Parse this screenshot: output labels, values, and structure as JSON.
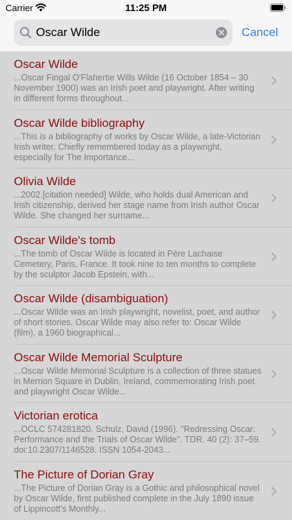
{
  "status_bar": {
    "carrier": "Carrier",
    "time": "11:25 PM"
  },
  "search": {
    "query": "Oscar Wilde",
    "cancel_label": "Cancel"
  },
  "results": [
    {
      "title": "Oscar Wilde",
      "snippet": "...Oscar Fingal O'Flahertie Wills Wilde (16 October 1854 – 30 November 1900) was an Irish poet and playwright. After writing in different forms throughout..."
    },
    {
      "title": "Oscar Wilde bibliography",
      "snippet": "...This is a bibliography of works by Oscar Wilde, a late-Victorian Irish writer. Chiefly remembered today as a playwright, especially for The Importance..."
    },
    {
      "title": "Olivia Wilde",
      "snippet": "...2002.[citation needed] Wilde, who holds dual American and Irish citizenship, derived her stage name from Irish author Oscar Wilde. She changed her surname..."
    },
    {
      "title": "Oscar Wilde's tomb",
      "snippet": "...The tomb of Oscar Wilde is located in Père Lachaise Cemetery, Paris, France. It took nine to ten months to complete by the sculptor Jacob Epstein, with..."
    },
    {
      "title": "Oscar Wilde (disambiguation)",
      "snippet": "...Oscar Wilde was an Irish playwright, novelist, poet, and author of short stories. Oscar Wilde may also refer to: Oscar Wilde (film), a 1960 biographical..."
    },
    {
      "title": "Oscar Wilde Memorial Sculpture",
      "snippet": "...Oscar Wilde Memorial Sculpture is a collection of three statues in Merrion Square in Dublin, Ireland, commemorating Irish poet and playwright Oscar Wilde..."
    },
    {
      "title": "Victorian erotica",
      "snippet": "...OCLC 574281820. Schulz, David (1996). \"Redressing Oscar: Performance and the Trials of Oscar Wilde\". TDR. 40 (2): 37–59. doi:10.2307/1146528. ISSN 1054-2043..."
    },
    {
      "title": "The Picture of Dorian Gray",
      "snippet": "...The Picture of Dorian Gray is a Gothic and philosophical novel by Oscar Wilde, first published complete in the July 1890 issue of Lippincott's Monthly..."
    }
  ]
}
